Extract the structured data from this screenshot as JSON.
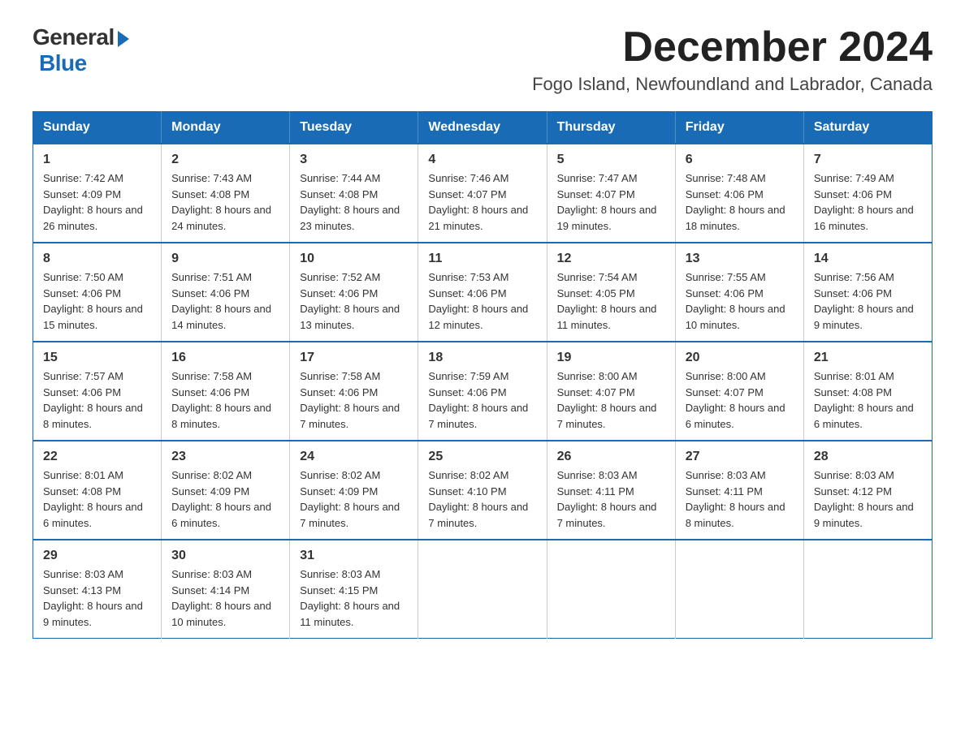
{
  "logo": {
    "general": "General",
    "blue": "Blue"
  },
  "title": "December 2024",
  "location": "Fogo Island, Newfoundland and Labrador, Canada",
  "days_of_week": [
    "Sunday",
    "Monday",
    "Tuesday",
    "Wednesday",
    "Thursday",
    "Friday",
    "Saturday"
  ],
  "weeks": [
    [
      {
        "day": "1",
        "sunrise": "7:42 AM",
        "sunset": "4:09 PM",
        "daylight": "8 hours and 26 minutes."
      },
      {
        "day": "2",
        "sunrise": "7:43 AM",
        "sunset": "4:08 PM",
        "daylight": "8 hours and 24 minutes."
      },
      {
        "day": "3",
        "sunrise": "7:44 AM",
        "sunset": "4:08 PM",
        "daylight": "8 hours and 23 minutes."
      },
      {
        "day": "4",
        "sunrise": "7:46 AM",
        "sunset": "4:07 PM",
        "daylight": "8 hours and 21 minutes."
      },
      {
        "day": "5",
        "sunrise": "7:47 AM",
        "sunset": "4:07 PM",
        "daylight": "8 hours and 19 minutes."
      },
      {
        "day": "6",
        "sunrise": "7:48 AM",
        "sunset": "4:06 PM",
        "daylight": "8 hours and 18 minutes."
      },
      {
        "day": "7",
        "sunrise": "7:49 AM",
        "sunset": "4:06 PM",
        "daylight": "8 hours and 16 minutes."
      }
    ],
    [
      {
        "day": "8",
        "sunrise": "7:50 AM",
        "sunset": "4:06 PM",
        "daylight": "8 hours and 15 minutes."
      },
      {
        "day": "9",
        "sunrise": "7:51 AM",
        "sunset": "4:06 PM",
        "daylight": "8 hours and 14 minutes."
      },
      {
        "day": "10",
        "sunrise": "7:52 AM",
        "sunset": "4:06 PM",
        "daylight": "8 hours and 13 minutes."
      },
      {
        "day": "11",
        "sunrise": "7:53 AM",
        "sunset": "4:06 PM",
        "daylight": "8 hours and 12 minutes."
      },
      {
        "day": "12",
        "sunrise": "7:54 AM",
        "sunset": "4:05 PM",
        "daylight": "8 hours and 11 minutes."
      },
      {
        "day": "13",
        "sunrise": "7:55 AM",
        "sunset": "4:06 PM",
        "daylight": "8 hours and 10 minutes."
      },
      {
        "day": "14",
        "sunrise": "7:56 AM",
        "sunset": "4:06 PM",
        "daylight": "8 hours and 9 minutes."
      }
    ],
    [
      {
        "day": "15",
        "sunrise": "7:57 AM",
        "sunset": "4:06 PM",
        "daylight": "8 hours and 8 minutes."
      },
      {
        "day": "16",
        "sunrise": "7:58 AM",
        "sunset": "4:06 PM",
        "daylight": "8 hours and 8 minutes."
      },
      {
        "day": "17",
        "sunrise": "7:58 AM",
        "sunset": "4:06 PM",
        "daylight": "8 hours and 7 minutes."
      },
      {
        "day": "18",
        "sunrise": "7:59 AM",
        "sunset": "4:06 PM",
        "daylight": "8 hours and 7 minutes."
      },
      {
        "day": "19",
        "sunrise": "8:00 AM",
        "sunset": "4:07 PM",
        "daylight": "8 hours and 7 minutes."
      },
      {
        "day": "20",
        "sunrise": "8:00 AM",
        "sunset": "4:07 PM",
        "daylight": "8 hours and 6 minutes."
      },
      {
        "day": "21",
        "sunrise": "8:01 AM",
        "sunset": "4:08 PM",
        "daylight": "8 hours and 6 minutes."
      }
    ],
    [
      {
        "day": "22",
        "sunrise": "8:01 AM",
        "sunset": "4:08 PM",
        "daylight": "8 hours and 6 minutes."
      },
      {
        "day": "23",
        "sunrise": "8:02 AM",
        "sunset": "4:09 PM",
        "daylight": "8 hours and 6 minutes."
      },
      {
        "day": "24",
        "sunrise": "8:02 AM",
        "sunset": "4:09 PM",
        "daylight": "8 hours and 7 minutes."
      },
      {
        "day": "25",
        "sunrise": "8:02 AM",
        "sunset": "4:10 PM",
        "daylight": "8 hours and 7 minutes."
      },
      {
        "day": "26",
        "sunrise": "8:03 AM",
        "sunset": "4:11 PM",
        "daylight": "8 hours and 7 minutes."
      },
      {
        "day": "27",
        "sunrise": "8:03 AM",
        "sunset": "4:11 PM",
        "daylight": "8 hours and 8 minutes."
      },
      {
        "day": "28",
        "sunrise": "8:03 AM",
        "sunset": "4:12 PM",
        "daylight": "8 hours and 9 minutes."
      }
    ],
    [
      {
        "day": "29",
        "sunrise": "8:03 AM",
        "sunset": "4:13 PM",
        "daylight": "8 hours and 9 minutes."
      },
      {
        "day": "30",
        "sunrise": "8:03 AM",
        "sunset": "4:14 PM",
        "daylight": "8 hours and 10 minutes."
      },
      {
        "day": "31",
        "sunrise": "8:03 AM",
        "sunset": "4:15 PM",
        "daylight": "8 hours and 11 minutes."
      },
      null,
      null,
      null,
      null
    ]
  ]
}
